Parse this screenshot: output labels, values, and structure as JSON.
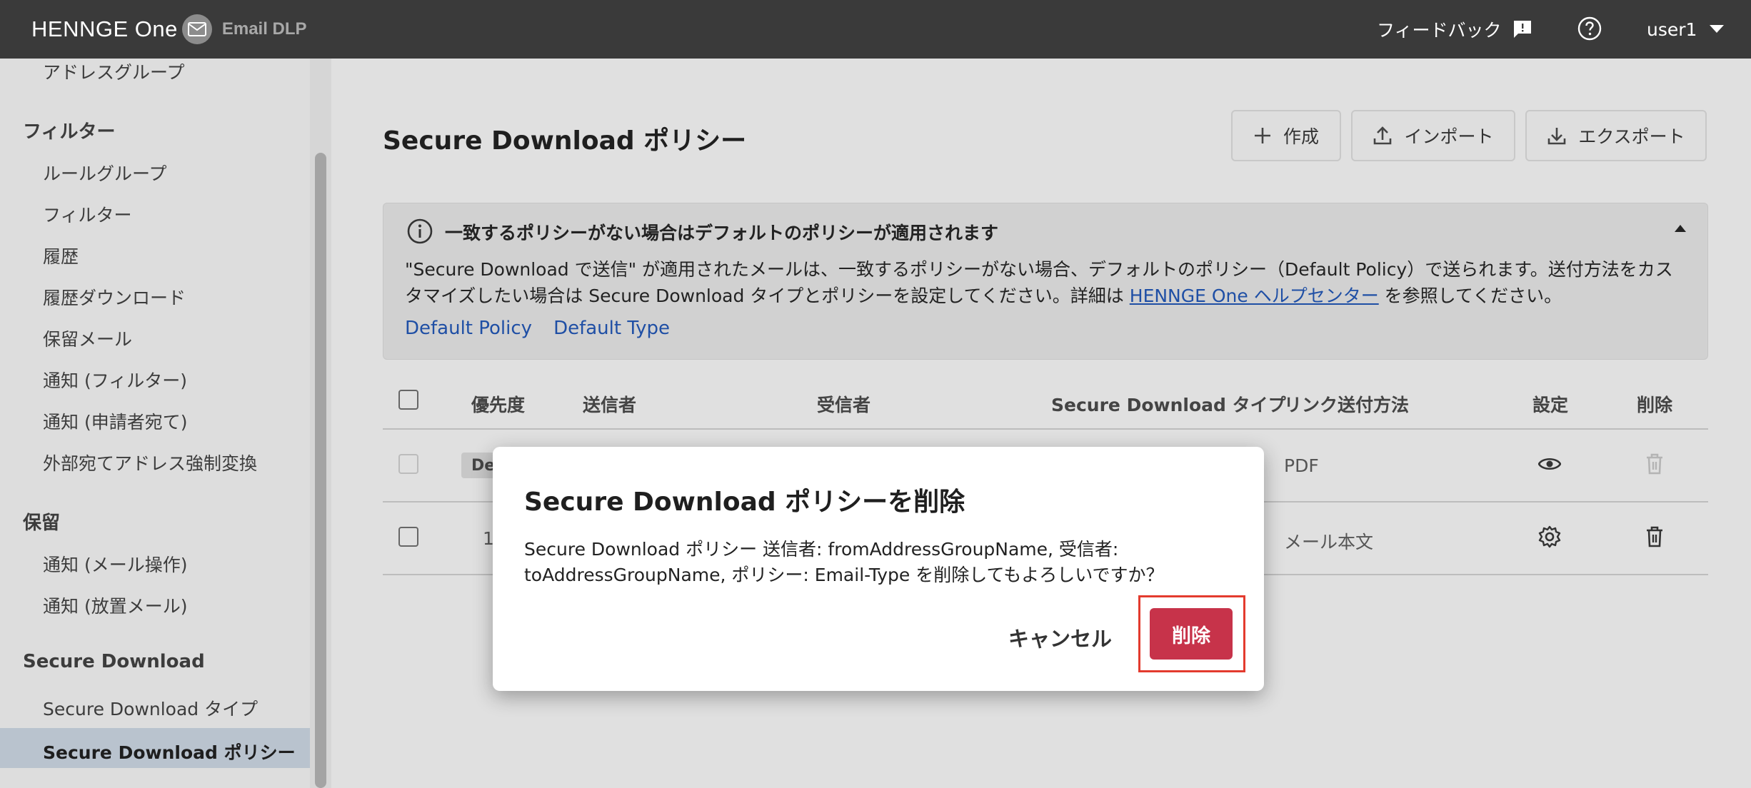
{
  "header": {
    "logo_text": "HENNGE One",
    "product": "Email DLP",
    "feedback_label": "フィードバック",
    "user": "user1"
  },
  "sidebar": {
    "top_item": "アドレスグループ",
    "sections": [
      {
        "title": "フィルター",
        "items": [
          "ルールグループ",
          "フィルター",
          "履歴",
          "履歴ダウンロード",
          "保留メール",
          "通知 (フィルター)",
          "通知 (申請者宛て)",
          "外部宛てアドレス強制変換"
        ]
      },
      {
        "title": "保留",
        "items": [
          "通知 (メール操作)",
          "通知 (放置メール)"
        ]
      },
      {
        "title": "Secure Download",
        "items": [
          "Secure Download タイプ",
          "Secure Download ポリシー"
        ]
      }
    ],
    "active_item": "Secure Download ポリシー"
  },
  "main": {
    "title": "Secure Download ポリシー",
    "buttons": {
      "create": "作成",
      "import": "インポート",
      "export": "エクスポート"
    },
    "info": {
      "title": "一致するポリシーがない場合はデフォルトのポリシーが適用されます",
      "body_before_link": "\"Secure Download で送信\" が適用されたメールは、一致するポリシーがない場合、デフォルトのポリシー（Default Policy）で送られます。送付方法をカスタマイズしたい場合は Secure Download タイプとポリシーを設定してください。詳細は ",
      "link_text": "HENNGE One ヘルプセンター",
      "body_after_link": " を参照してください。",
      "action_policy": "Default Policy",
      "action_type": "Default Type"
    },
    "table": {
      "headers": {
        "priority": "優先度",
        "sender": "送信者",
        "recipient": "受信者",
        "sd_type": "Secure Download タイプ",
        "link_method": "リンク送付方法",
        "settings": "設定",
        "delete": "削除"
      },
      "rows": [
        {
          "priority_tag": "Default",
          "link_method": "PDF"
        },
        {
          "priority": "1",
          "link_method": "メール本文"
        }
      ]
    }
  },
  "dialog": {
    "title": "Secure Download ポリシーを削除",
    "body": "Secure Download ポリシー 送信者: fromAddressGroupName, 受信者: toAddressGroupName, ポリシー: Email-Type を削除してもよろしいですか？",
    "cancel": "キャンセル",
    "delete": "削除"
  },
  "colors": {
    "header_bg": "#3a3a3a",
    "link": "#1f4fa5",
    "danger": "#c7334a",
    "highlight": "#e33b2e",
    "sidebar_active": "#b9c3ce"
  }
}
